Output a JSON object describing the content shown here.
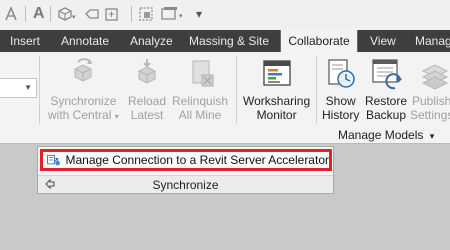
{
  "quick_access": {
    "letter_icon": "A",
    "dropdown_glyph": "▾",
    "icons": [
      "text-icon",
      "3d-view-icon",
      "tag-icon",
      "thin-lines-icon",
      "switch-windows-icon",
      "customize-icon"
    ]
  },
  "tabs": [
    {
      "label": "Insert",
      "active": false
    },
    {
      "label": "Annotate",
      "active": false
    },
    {
      "label": "Analyze",
      "active": false
    },
    {
      "label": "Massing & Site",
      "active": false
    },
    {
      "label": "Collaborate",
      "active": true
    },
    {
      "label": "View",
      "active": false
    },
    {
      "label": "Manag",
      "active": false
    }
  ],
  "ribbon": {
    "synchronize": {
      "line1": "Synchronize",
      "line2": "with Central",
      "caret": "▾",
      "enabled": false,
      "icon": "sync-icon"
    },
    "reload_latest": {
      "line1": "Reload",
      "line2": "Latest",
      "enabled": false,
      "icon": "reload-icon"
    },
    "relinquish": {
      "line1": "Relinquish",
      "line2": "All Mine",
      "enabled": false,
      "icon": "relinquish-icon"
    },
    "worksharing_monitor": {
      "line1": "Worksharing",
      "line2": "Monitor",
      "enabled": true,
      "icon": "monitor-icon"
    },
    "show_history": {
      "line1": "Show",
      "line2": "History",
      "enabled": true,
      "icon": "history-icon"
    },
    "restore_backup": {
      "line1": "Restore",
      "line2": "Backup",
      "enabled": true,
      "icon": "backup-icon"
    },
    "publish_settings": {
      "line1": "Publish",
      "line2": "Settings",
      "enabled": false,
      "icon": "publish-icon"
    },
    "manage_models_label": "Manage Models",
    "manage_models_caret": "▾"
  },
  "popup": {
    "menu_item": "Manage Connection to a Revit Server Accelerator",
    "panel_title": "Synchronize",
    "highlight_color": "#e2202c"
  }
}
